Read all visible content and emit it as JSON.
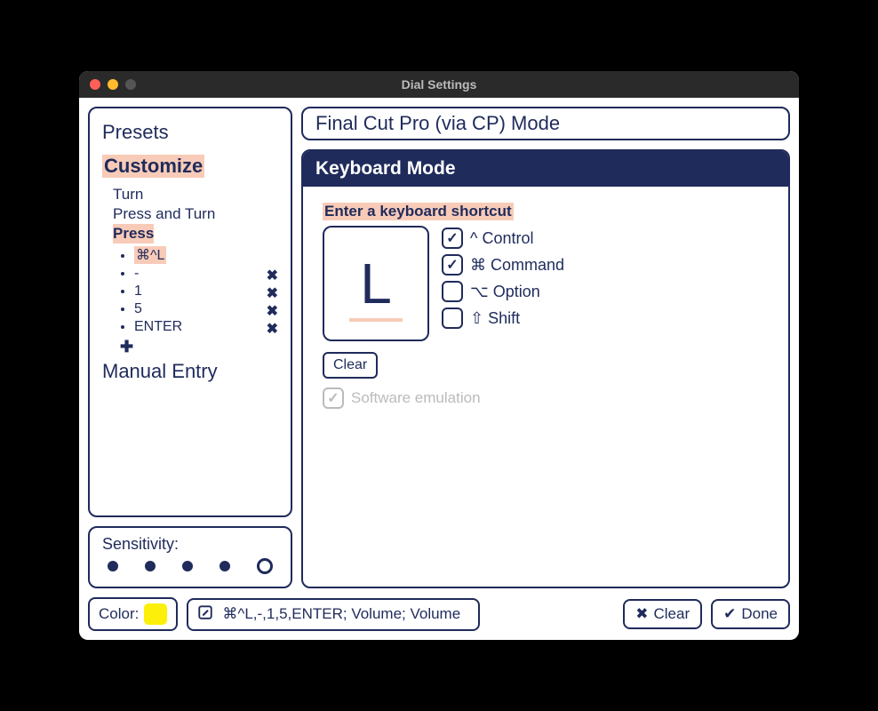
{
  "window": {
    "title": "Dial Settings"
  },
  "sidebar": {
    "presets": "Presets",
    "customize": "Customize",
    "items": {
      "turn": "Turn",
      "press_and_turn": "Press and Turn",
      "press": "Press"
    },
    "press_actions": [
      {
        "label": "⌘^L",
        "closable": false,
        "highlighted": true
      },
      {
        "label": "-",
        "closable": true
      },
      {
        "label": "1",
        "closable": true
      },
      {
        "label": "5",
        "closable": true
      },
      {
        "label": "ENTER",
        "closable": true
      }
    ],
    "manual_entry": "Manual Entry"
  },
  "sensitivity": {
    "label": "Sensitivity:",
    "levels": 5,
    "selected": 4
  },
  "mode": {
    "title": "Final Cut Pro (via CP) Mode"
  },
  "keyboard_panel": {
    "header": "Keyboard Mode",
    "shortcut_label": "Enter a keyboard shortcut",
    "key": "L",
    "modifiers": {
      "control": {
        "label": "^ Control",
        "checked": true
      },
      "command": {
        "label": "⌘ Command",
        "checked": true
      },
      "option": {
        "label": "⌥ Option",
        "checked": false
      },
      "shift": {
        "label": "⇧ Shift",
        "checked": false
      }
    },
    "clear_label": "Clear",
    "emulation_label": "Software emulation",
    "emulation_checked": true
  },
  "footer": {
    "color_label": "Color:",
    "color_value": "#fcf00a",
    "text_value": "⌘^L,-,1,5,ENTER; Volume; Volume",
    "clear_label": "Clear",
    "done_label": "Done"
  }
}
